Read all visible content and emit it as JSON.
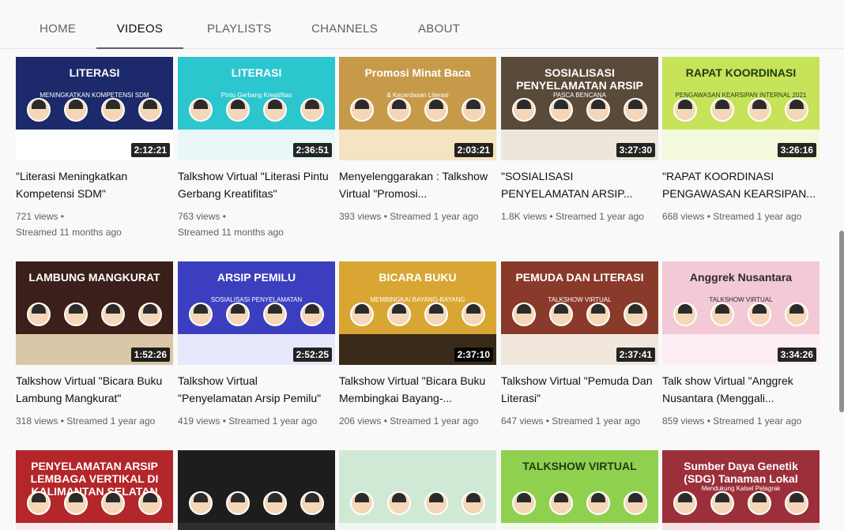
{
  "tabs": [
    {
      "label": "HOME",
      "active": false
    },
    {
      "label": "VIDEOS",
      "active": true
    },
    {
      "label": "PLAYLISTS",
      "active": false
    },
    {
      "label": "CHANNELS",
      "active": false
    },
    {
      "label": "ABOUT",
      "active": false
    }
  ],
  "videos": [
    {
      "title": "\"Literasi Meningkatkan Kompetensi SDM\"",
      "views": "721 views",
      "streamed": "Streamed 11 months ago",
      "duration": "2:12:21",
      "thumb_text": "LITERASI",
      "thumb_sub": "MENINGKATKAN KOMPETENSI SDM",
      "colors": {
        "bg": "#1c2a6b",
        "band": "#ffffff",
        "text": "#ffffff"
      }
    },
    {
      "title": "Talkshow Virtual \"Literasi Pintu Gerbang Kreatifitas\"",
      "views": "763 views",
      "streamed": "Streamed 11 months ago",
      "duration": "2:36:51",
      "thumb_text": "LITERASI",
      "thumb_sub": "Pintu Gerbang Kreatifitas",
      "colors": {
        "bg": "#2cc6cf",
        "band": "#e9f7f8",
        "text": "#ffffff"
      }
    },
    {
      "title": "Menyelenggarakan : Talkshow Virtual \"Promosi...",
      "views": "393 views",
      "streamed": "Streamed 1 year ago",
      "duration": "2:03:21",
      "thumb_text": "Promosi Minat Baca",
      "thumb_sub": "& Kecerdasan Literasi",
      "colors": {
        "bg": "#c79a4a",
        "band": "#f4e4c2",
        "text": "#ffffff"
      }
    },
    {
      "title": "\"SOSIALISASI PENYELAMATAN ARSIP...",
      "views": "1.8K views",
      "streamed": "Streamed 1 year ago",
      "duration": "3:27:30",
      "thumb_text": "SOSIALISASI PENYELAMATAN ARSIP",
      "thumb_sub": "PASCA BENCANA",
      "colors": {
        "bg": "#5a4a3a",
        "band": "#ece6dc",
        "text": "#ffffff"
      }
    },
    {
      "title": "\"RAPAT KOORDINASI PENGAWASAN KEARSIPAN...",
      "views": "668 views",
      "streamed": "Streamed 1 year ago",
      "duration": "3:26:16",
      "thumb_text": "RAPAT KOORDINASI",
      "thumb_sub": "PENGAWASAN KEARSIPAN INTERNAL 2021",
      "colors": {
        "bg": "#c6e35a",
        "band": "#f3f9dc",
        "text": "#1f3b12"
      }
    },
    {
      "title": "Talkshow Virtual \"Bicara Buku Lambung Mangkurat\"",
      "views": "318 views",
      "streamed": "Streamed 1 year ago",
      "duration": "1:52:26",
      "thumb_text": "LAMBUNG MANGKURAT",
      "thumb_sub": "",
      "colors": {
        "bg": "#3a1f1a",
        "band": "#d9c7a8",
        "text": "#ffffff"
      }
    },
    {
      "title": "Talkshow Virtual \"Penyelamatan Arsip Pemilu\"",
      "views": "419 views",
      "streamed": "Streamed 1 year ago",
      "duration": "2:52:25",
      "thumb_text": "ARSIP PEMILU",
      "thumb_sub": "SOSIALISASI PENYELAMATAN",
      "colors": {
        "bg": "#3b3fbf",
        "band": "#e7e8fb",
        "text": "#ffffff"
      }
    },
    {
      "title": "Talkshow Virtual \"Bicara Buku Membingkai Bayang-...",
      "views": "206 views",
      "streamed": "Streamed 1 year ago",
      "duration": "2:37:10",
      "thumb_text": "BICARA BUKU",
      "thumb_sub": "MEMBINGKAI BAYANG-BAYANG",
      "colors": {
        "bg": "#d9a633",
        "band": "#3a2a1a",
        "text": "#ffffff"
      }
    },
    {
      "title": "Talkshow Virtual \"Pemuda Dan Literasi\"",
      "views": "647 views",
      "streamed": "Streamed 1 year ago",
      "duration": "2:37:41",
      "thumb_text": "PEMUDA DAN LITERASI",
      "thumb_sub": "TALKSHOW VIRTUAL",
      "colors": {
        "bg": "#8a3a2a",
        "band": "#f1e7dc",
        "text": "#ffffff"
      }
    },
    {
      "title": "Talk show Virtual \"Anggrek Nusantara (Menggali...",
      "views": "859 views",
      "streamed": "Streamed 1 year ago",
      "duration": "3:34:26",
      "thumb_text": "Anggrek Nusantara",
      "thumb_sub": "TALKSHOW VIRTUAL",
      "colors": {
        "bg": "#f3c9d6",
        "band": "#fdeef3",
        "text": "#2a2a2a"
      }
    },
    {
      "title": "",
      "views": "",
      "streamed": "",
      "duration": "",
      "thumb_text": "PENYELAMATAN ARSIP LEMBAGA VERTIKAL DI KALIMANTAN SELATAN",
      "thumb_sub": "",
      "colors": {
        "bg": "#b3262a",
        "band": "#fbe8e8",
        "text": "#ffffff"
      }
    },
    {
      "title": "",
      "views": "",
      "streamed": "",
      "duration": "",
      "thumb_text": "",
      "thumb_sub": "",
      "colors": {
        "bg": "#1d1d1d",
        "band": "#2e2e2e",
        "text": "#ffffff"
      }
    },
    {
      "title": "",
      "views": "",
      "streamed": "",
      "duration": "",
      "thumb_text": "",
      "thumb_sub": "",
      "colors": {
        "bg": "#cfe9d5",
        "band": "#eef8f0",
        "text": "#2a2a2a"
      }
    },
    {
      "title": "",
      "views": "",
      "streamed": "",
      "duration": "",
      "thumb_text": "TALKSHOW VIRTUAL",
      "thumb_sub": "",
      "colors": {
        "bg": "#8fd14f",
        "band": "#f2faea",
        "text": "#1e3d12"
      }
    },
    {
      "title": "",
      "views": "",
      "streamed": "",
      "duration": "",
      "thumb_text": "Sumber Daya Genetik (SDG) Tanaman Lokal",
      "thumb_sub": "Mendukung Kalsel Pelagrak",
      "colors": {
        "bg": "#9b2f3a",
        "band": "#f7e1e4",
        "text": "#ffffff"
      }
    }
  ]
}
